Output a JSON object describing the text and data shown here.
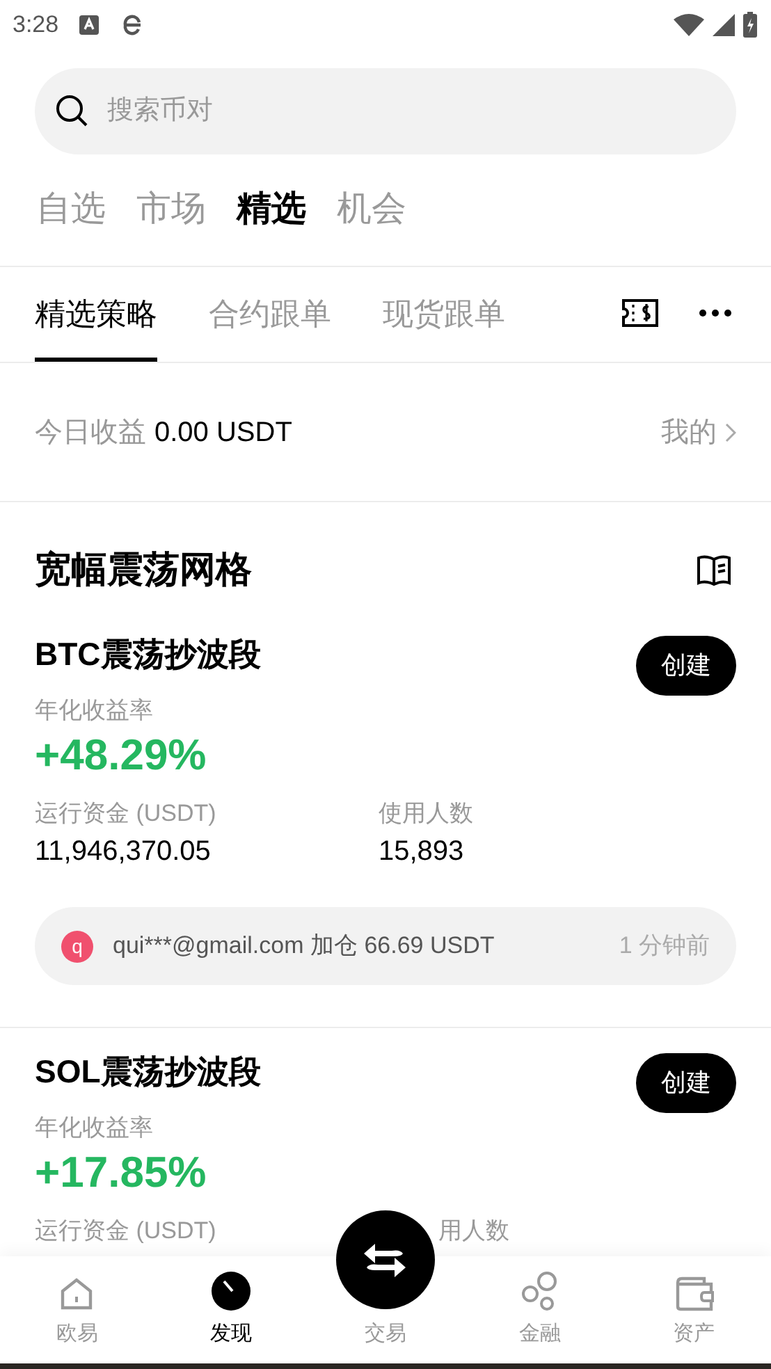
{
  "status_bar": {
    "time": "3:28"
  },
  "search": {
    "placeholder": "搜索币对"
  },
  "top_tabs": [
    {
      "label": "自选",
      "selected": false
    },
    {
      "label": "市场",
      "selected": false
    },
    {
      "label": "精选",
      "selected": true
    },
    {
      "label": "机会",
      "selected": false
    }
  ],
  "sub_tabs": [
    {
      "label": "精选策略",
      "selected": true
    },
    {
      "label": "合约跟单",
      "selected": false
    },
    {
      "label": "现货跟单",
      "selected": false
    }
  ],
  "earnings": {
    "label": "今日收益",
    "value": "0.00 USDT",
    "link": "我的"
  },
  "section": {
    "title": "宽幅震荡网格"
  },
  "strategies": [
    {
      "name": "BTC震荡抄波段",
      "button": "创建",
      "rate_label": "年化收益率",
      "rate": "+48.29%",
      "funds_label": "运行资金 (USDT)",
      "funds": "11,946,370.05",
      "users_label": "使用人数",
      "users": "15,893",
      "feed": {
        "avatar": "q",
        "color": "#f0506e",
        "text": "qui***@gmail.com 加仓 66.69 USDT",
        "time": "1 分钟前"
      }
    },
    {
      "name": "SOL震荡抄波段",
      "button": "创建",
      "rate_label": "年化收益率",
      "rate": "+17.85%",
      "funds_label": "运行资金 (USDT)",
      "users_label": "用人数"
    }
  ],
  "bottom_nav": [
    {
      "label": "欧易",
      "selected": false
    },
    {
      "label": "发现",
      "selected": true
    },
    {
      "label": "交易",
      "selected": false
    },
    {
      "label": "金融",
      "selected": false
    },
    {
      "label": "资产",
      "selected": false
    }
  ]
}
